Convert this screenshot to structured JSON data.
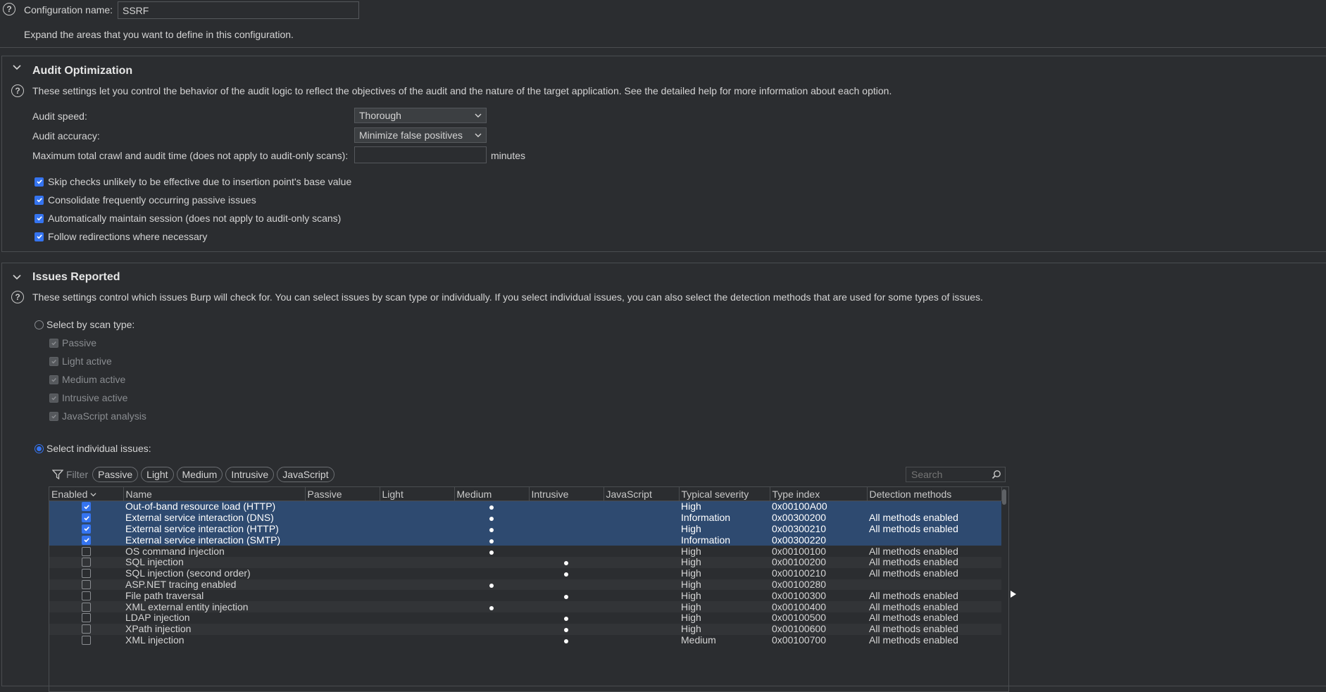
{
  "config": {
    "name_label": "Configuration name:",
    "name_value": "SSRF",
    "expand_hint": "Expand the areas that you want to define in this configuration."
  },
  "audit": {
    "title": "Audit Optimization",
    "description": "These settings let you control the behavior of the audit logic to reflect the objectives of the audit and the nature of the target application. See the detailed help for more information about each option.",
    "speed_label": "Audit speed:",
    "speed_value": "Thorough",
    "accuracy_label": "Audit accuracy:",
    "accuracy_value": "Minimize false positives",
    "maxtime_label": "Maximum total crawl and audit time (does not apply to audit-only scans):",
    "maxtime_value": "",
    "maxtime_unit": "minutes",
    "options": [
      {
        "label": "Skip checks unlikely to be effective due to insertion point's base value",
        "checked": true
      },
      {
        "label": "Consolidate frequently occurring passive issues",
        "checked": true
      },
      {
        "label": "Automatically maintain session (does not apply to audit-only scans)",
        "checked": true
      },
      {
        "label": "Follow redirections where necessary",
        "checked": true
      }
    ]
  },
  "issues": {
    "title": "Issues Reported",
    "description": "These settings control which issues Burp will check for. You can select issues by scan type or individually. If you select individual issues, you can also select the detection methods that are used for some types of issues.",
    "by_scan_type_label": "Select by scan type:",
    "scan_types": [
      "Passive",
      "Light active",
      "Medium active",
      "Intrusive active",
      "JavaScript analysis"
    ],
    "individual_label": "Select individual issues:",
    "filter_label": "Filter",
    "filter_chips": [
      "Passive",
      "Light",
      "Medium",
      "Intrusive",
      "JavaScript"
    ],
    "search_placeholder": "Search",
    "columns": [
      "Enabled",
      "Name",
      "Passive",
      "Light",
      "Medium",
      "Intrusive",
      "JavaScript",
      "Typical severity",
      "Type index",
      "Detection methods"
    ],
    "rows": [
      {
        "enabled": true,
        "name": "Out-of-band resource load (HTTP)",
        "scan": "medium",
        "severity": "High",
        "index": "0x00100A00",
        "methods": "",
        "selected": true
      },
      {
        "enabled": true,
        "name": "External service interaction (DNS)",
        "scan": "medium",
        "severity": "Information",
        "index": "0x00300200",
        "methods": "All methods enabled",
        "selected": true
      },
      {
        "enabled": true,
        "name": "External service interaction (HTTP)",
        "scan": "medium",
        "severity": "High",
        "index": "0x00300210",
        "methods": "All methods enabled",
        "selected": true
      },
      {
        "enabled": true,
        "name": "External service interaction (SMTP)",
        "scan": "medium",
        "severity": "Information",
        "index": "0x00300220",
        "methods": "",
        "selected": true
      },
      {
        "enabled": false,
        "name": "OS command injection",
        "scan": "medium",
        "severity": "High",
        "index": "0x00100100",
        "methods": "All methods enabled",
        "selected": false
      },
      {
        "enabled": false,
        "name": "SQL injection",
        "scan": "intrusive",
        "severity": "High",
        "index": "0x00100200",
        "methods": "All methods enabled",
        "selected": false
      },
      {
        "enabled": false,
        "name": "SQL injection (second order)",
        "scan": "intrusive",
        "severity": "High",
        "index": "0x00100210",
        "methods": "All methods enabled",
        "selected": false
      },
      {
        "enabled": false,
        "name": "ASP.NET tracing enabled",
        "scan": "medium",
        "severity": "High",
        "index": "0x00100280",
        "methods": "",
        "selected": false
      },
      {
        "enabled": false,
        "name": "File path traversal",
        "scan": "intrusive",
        "severity": "High",
        "index": "0x00100300",
        "methods": "All methods enabled",
        "selected": false
      },
      {
        "enabled": false,
        "name": "XML external entity injection",
        "scan": "medium",
        "severity": "High",
        "index": "0x00100400",
        "methods": "All methods enabled",
        "selected": false
      },
      {
        "enabled": false,
        "name": "LDAP injection",
        "scan": "intrusive",
        "severity": "High",
        "index": "0x00100500",
        "methods": "All methods enabled",
        "selected": false
      },
      {
        "enabled": false,
        "name": "XPath injection",
        "scan": "intrusive",
        "severity": "High",
        "index": "0x00100600",
        "methods": "All methods enabled",
        "selected": false
      },
      {
        "enabled": false,
        "name": "XML injection",
        "scan": "intrusive",
        "severity": "Medium",
        "index": "0x00100700",
        "methods": "All methods enabled",
        "selected": false
      }
    ]
  },
  "colors": {
    "background": "#2b2d30",
    "accent": "#3574f0",
    "selection": "#2e4a70"
  }
}
